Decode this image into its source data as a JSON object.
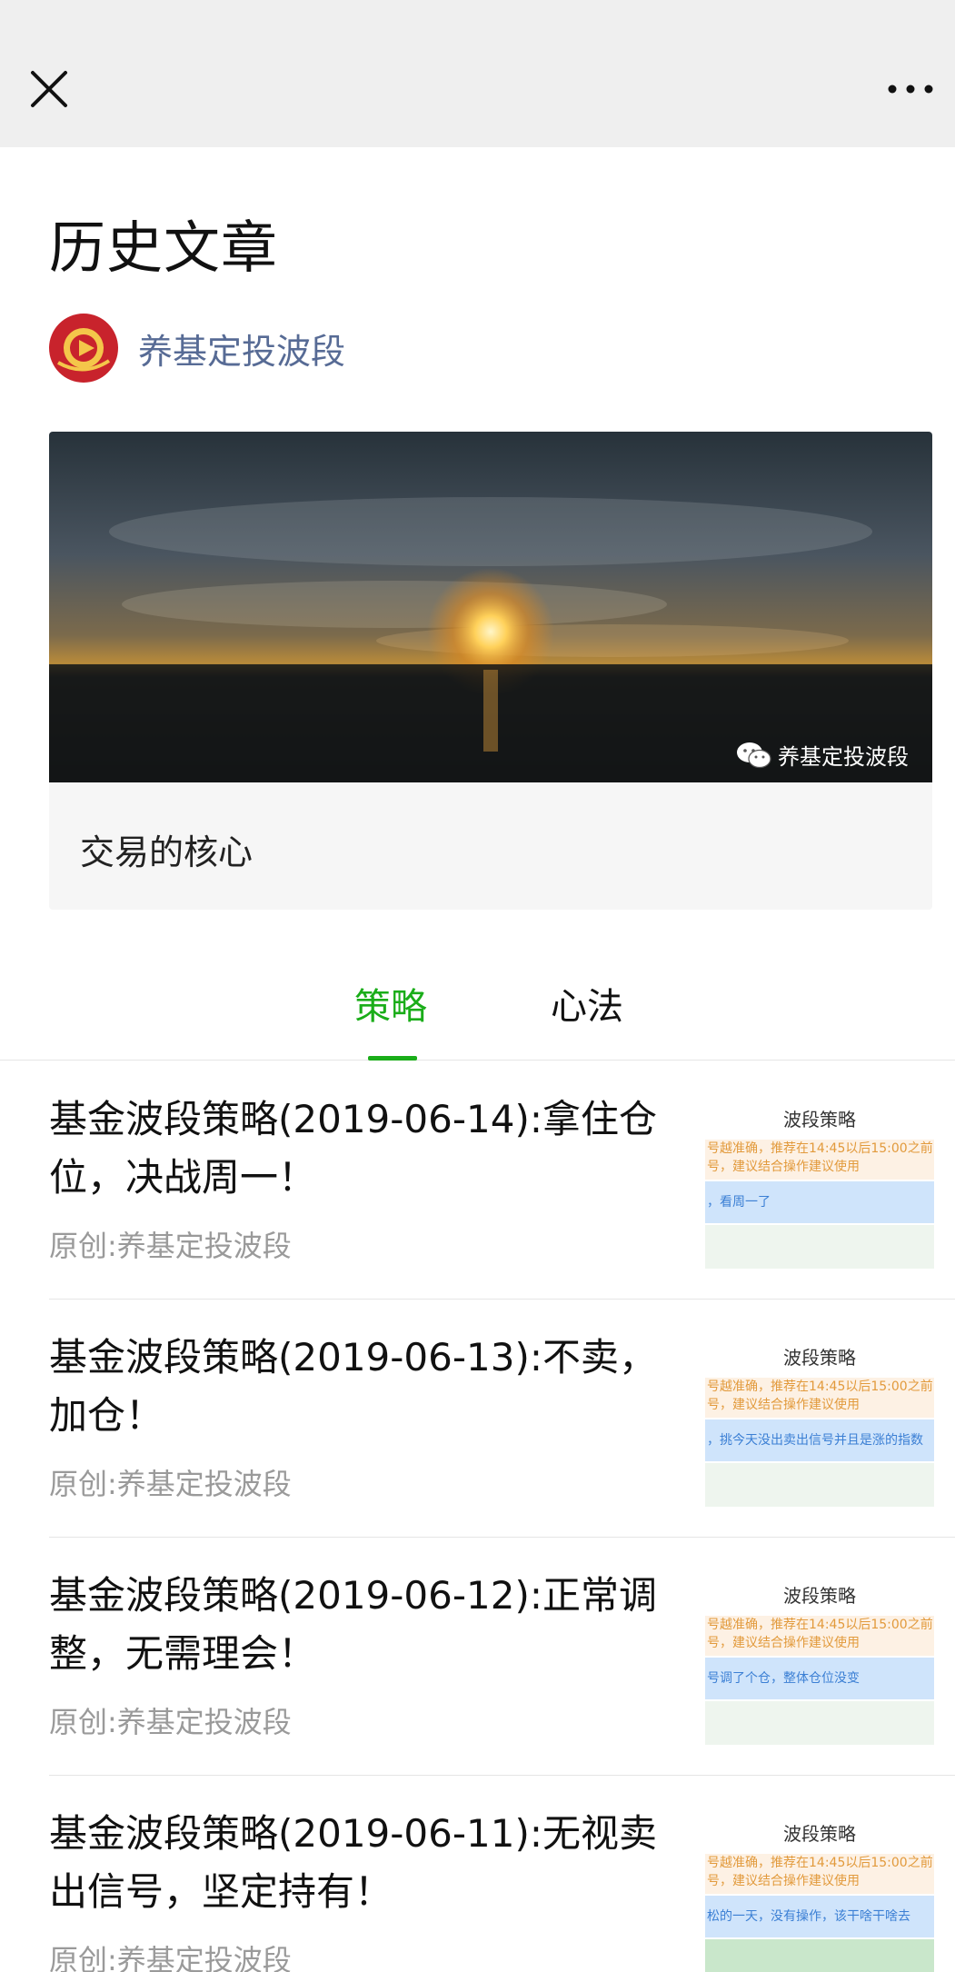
{
  "header": {
    "close_icon": "close-icon",
    "more_icon": "more-icon"
  },
  "page": {
    "title": "历史文章"
  },
  "account": {
    "name": "养基定投波段",
    "avatar_icon": "account-logo-icon",
    "brand_color": "#c8232c"
  },
  "featured": {
    "watermark_text": "养基定投波段",
    "title": "交易的核心"
  },
  "tabs": [
    {
      "label": "策略",
      "active": true
    },
    {
      "label": "心法",
      "active": false
    }
  ],
  "colors": {
    "accent": "#1aad19",
    "link": "#576b95",
    "muted": "#9a9a9a"
  },
  "articles": [
    {
      "title": "基金波段策略(2019-06-14):拿住仓位，决战周一！",
      "author": "原创:养基定投波段",
      "thumb": {
        "heading": "波段策略",
        "line1": "号越准确，推荐在14:45以后15:00之前",
        "line2": "号，建议结合操作建议使用",
        "line3": "，看周一了"
      }
    },
    {
      "title": "基金波段策略(2019-06-13):不卖，加仓！",
      "author": "原创:养基定投波段",
      "thumb": {
        "heading": "波段策略",
        "line1": "号越准确，推荐在14:45以后15:00之前",
        "line2": "号，建议结合操作建议使用",
        "line3": "，挑今天没出卖出信号并且是涨的指数"
      }
    },
    {
      "title": "基金波段策略(2019-06-12):正常调整，无需理会！",
      "author": "原创:养基定投波段",
      "thumb": {
        "heading": "波段策略",
        "line1": "号越准确，推荐在14:45以后15:00之前",
        "line2": "号，建议结合操作建议使用",
        "line3": "号调了个仓，整体仓位没变"
      }
    },
    {
      "title": "基金波段策略(2019-06-11):无视卖出信号，坚定持有！",
      "author": "原创:养基定投波段",
      "thumb": {
        "heading": "波段策略",
        "line1": "号越准确，推荐在14:45以后15:00之前",
        "line2": "号，建议结合操作建议使用",
        "line3": "松的一天，没有操作，该干啥干啥去"
      }
    }
  ]
}
